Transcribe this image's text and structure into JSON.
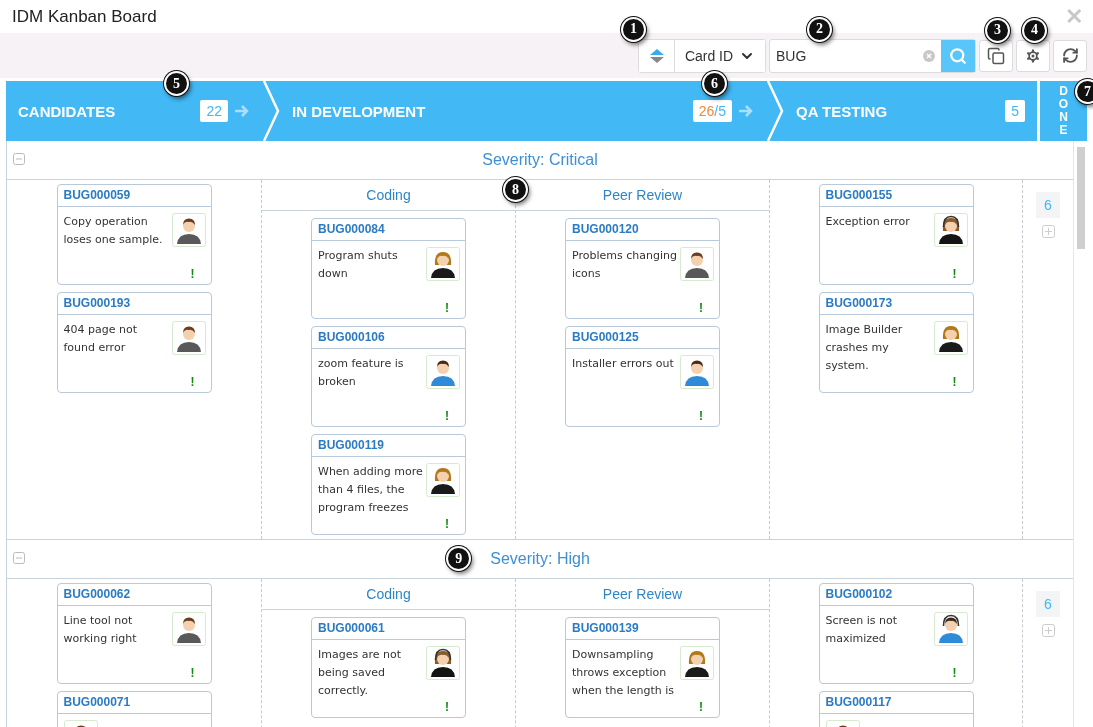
{
  "window": {
    "title": "IDM Kanban Board",
    "close": "✕"
  },
  "toolbar": {
    "sort": {
      "value": "Card ID",
      "callout": "1"
    },
    "search": {
      "value": "BUG",
      "callout": "2"
    },
    "buttons": [
      {
        "kind": "copy",
        "callout": "3"
      },
      {
        "kind": "settings",
        "callout": "4"
      },
      {
        "kind": "refresh"
      }
    ]
  },
  "columns": [
    {
      "kind": "stage",
      "title": "CANDIDATES",
      "count": "22",
      "over_limit": false,
      "callout": "5"
    },
    {
      "kind": "stage",
      "title": "IN DEVELOPMENT",
      "count": "26",
      "wip": "/5",
      "over_limit": true,
      "callout": "6"
    },
    {
      "kind": "stage",
      "title": "QA TESTING",
      "count": "5",
      "over_limit": false
    },
    {
      "kind": "collapsed",
      "title": "DONE",
      "callout": "7"
    }
  ],
  "lanes": [
    {
      "title": "Severity: Critical",
      "done_count": "6",
      "cells": [
        {
          "cards": [
            {
              "id": "BUG000059",
              "text": "Copy operation loses one sample.",
              "kind": "suit",
              "priority": "!"
            },
            {
              "id": "BUG000193",
              "text": "404 page not found error",
              "kind": "suit",
              "priority": "!"
            }
          ]
        },
        {
          "title": "Coding",
          "cards": [
            {
              "id": "BUG000084",
              "text": "Program shuts down",
              "kind": "woman",
              "priority": "!"
            },
            {
              "id": "BUG000106",
              "text": "zoom feature is broken",
              "kind": "casual",
              "priority": "!"
            },
            {
              "id": "BUG000119",
              "text": "When adding more than 4 files, the program freezes",
              "kind": "woman",
              "priority": "!"
            }
          ]
        },
        {
          "title": "Peer Review",
          "callout": "8",
          "cards": [
            {
              "id": "BUG000120",
              "text": "Problems changing icons",
              "kind": "suit",
              "priority": "!"
            },
            {
              "id": "BUG000125",
              "text": "Installer errors out",
              "kind": "casual",
              "priority": "!"
            }
          ]
        },
        {
          "cards": [
            {
              "id": "BUG000155",
              "text": "Exception error",
              "kind": "operator",
              "priority": "!"
            },
            {
              "id": "BUG000173",
              "text": "Image Builder crashes my system.",
              "kind": "woman",
              "priority": "!"
            }
          ]
        }
      ]
    },
    {
      "title": "Severity: High",
      "callout": "9",
      "done_count": "6",
      "cells": [
        {
          "cards": [
            {
              "id": "BUG000062",
              "text": "Line tool not working right",
              "kind": "suit",
              "priority": "!"
            },
            {
              "id": "BUG000071",
              "kind": "suit"
            }
          ]
        },
        {
          "title": "Coding",
          "cards": [
            {
              "id": "BUG000061",
              "text": "Images are not being saved correctly.",
              "kind": "operator",
              "priority": "!"
            }
          ]
        },
        {
          "title": "Peer Review",
          "cards": [
            {
              "id": "BUG000139",
              "text": "Downsampling throws exception when the length is",
              "kind": "woman",
              "priority": "!"
            }
          ]
        },
        {
          "cards": [
            {
              "id": "BUG000102",
              "text": "Screen is not maximized",
              "kind": "support",
              "priority": "!"
            },
            {
              "id": "BUG000117",
              "kind": "suit"
            }
          ]
        }
      ]
    }
  ]
}
